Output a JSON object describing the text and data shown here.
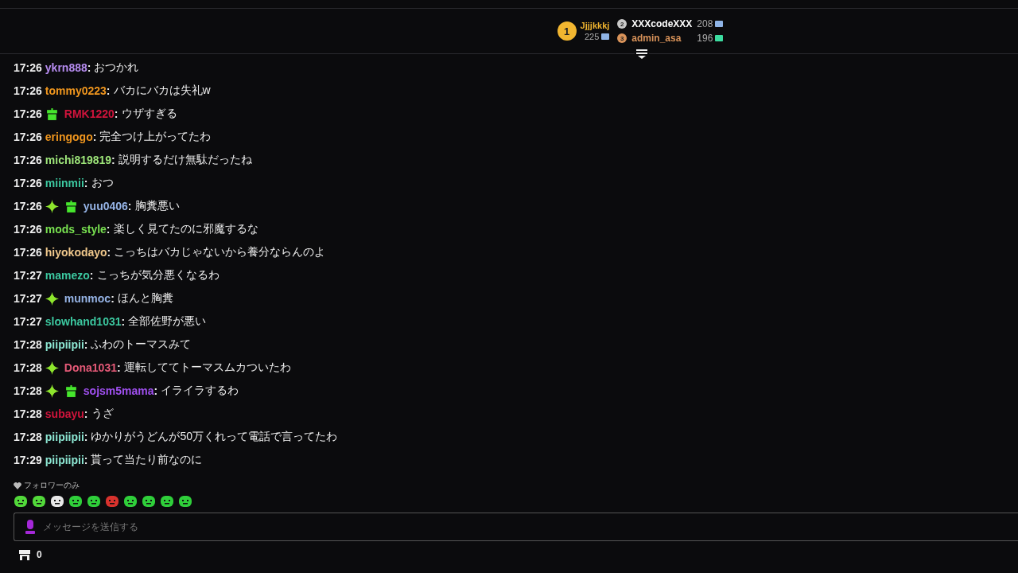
{
  "leaderboard": [
    {
      "rank": "1",
      "name": "Jjjjkkkj",
      "count": "225",
      "color": "#f2b630"
    },
    {
      "rank": "2",
      "name": "XXXcodeXXX",
      "count": "208",
      "color": "#c8c8c8"
    },
    {
      "rank": "3",
      "name": "admin_asa",
      "count": "196",
      "color": "#d9935a"
    }
  ],
  "messages": [
    {
      "time": "17:26",
      "user": "ykrn888",
      "color": "#b68cf0",
      "sep": ":",
      "text": "おつかれ"
    },
    {
      "time": "17:26",
      "user": "tommy0223",
      "color": "#f0961e",
      "sep": ":",
      "text": "バカにバカは失礼w"
    },
    {
      "time": "17:26",
      "badges": [
        {
          "kind": "gift"
        }
      ],
      "user": "RMK1220",
      "color": "#d0143c",
      "sep": ":",
      "text": "ウザすぎる"
    },
    {
      "time": "17:26",
      "user": "eringogo",
      "color": "#f0961e",
      "sep": ":",
      "text": "完全つけ上がってたわ"
    },
    {
      "time": "17:26",
      "user": "michi819819",
      "color": "#9ee67a",
      "sep": ":",
      "text": "説明するだけ無駄だったね"
    },
    {
      "time": "17:26",
      "user": "miinmii",
      "color": "#3cc8a0",
      "sep": ":",
      "text": "おつ"
    },
    {
      "time": "17:26",
      "badges": [
        {
          "kind": "sparkle"
        },
        {
          "kind": "gift"
        }
      ],
      "user": "yuu0406",
      "color": "#96b4e6",
      "sep": ":",
      "text": "胸糞悪い"
    },
    {
      "time": "17:26",
      "user": "mods_style",
      "color": "#78e050",
      "sep": ":",
      "text": "楽しく見てたのに邪魔するな"
    },
    {
      "time": "17:26",
      "user": "hiyokodayo",
      "color": "#f0c88c",
      "sep": ":",
      "text": "こっちはバカじゃないから養分ならんのよ"
    },
    {
      "time": "17:27",
      "user": "mamezo",
      "color": "#3cc8a0",
      "sep": ":",
      "text": "こっちが気分悪くなるわ"
    },
    {
      "time": "17:27",
      "badges": [
        {
          "kind": "sparkle"
        }
      ],
      "user": "munmoc",
      "color": "#96b4e6",
      "sep": ":",
      "text": "ほんと胸糞"
    },
    {
      "time": "17:27",
      "user": "slowhand1031",
      "color": "#3cc8a0",
      "sep": ":",
      "text": "全部佐野が悪い"
    },
    {
      "time": "17:28",
      "user": "piipiipii",
      "color": "#8ce6d2",
      "sep": ":",
      "text": "ふわのトーマスみて"
    },
    {
      "time": "17:28",
      "badges": [
        {
          "kind": "sparkle"
        }
      ],
      "user": "Dona1031",
      "color": "#e65a78",
      "sep": ":",
      "text": "運転しててトーマスムカついたわ"
    },
    {
      "time": "17:28",
      "badges": [
        {
          "kind": "sparkle"
        },
        {
          "kind": "gift"
        }
      ],
      "user": "sojsm5mama",
      "color": "#a050f0",
      "sep": ":",
      "text": "イライラするわ"
    },
    {
      "time": "17:28",
      "user": "subayu",
      "color": "#d0143c",
      "sep": ":",
      "text": "うざ"
    },
    {
      "time": "17:28",
      "user": "piipiipii",
      "color": "#8ce6d2",
      "sep": ":",
      "text": "ゆかりがうどんが50万くれって電話で言ってたわ"
    },
    {
      "time": "17:29",
      "user": "piipiipii",
      "color": "#8ce6d2",
      "sep": ":",
      "text": "貰って当たり前なのに"
    }
  ],
  "chat_mode": "フォロワーのみ",
  "input": {
    "placeholder": "メッセージを送信する"
  },
  "store_count": "0"
}
